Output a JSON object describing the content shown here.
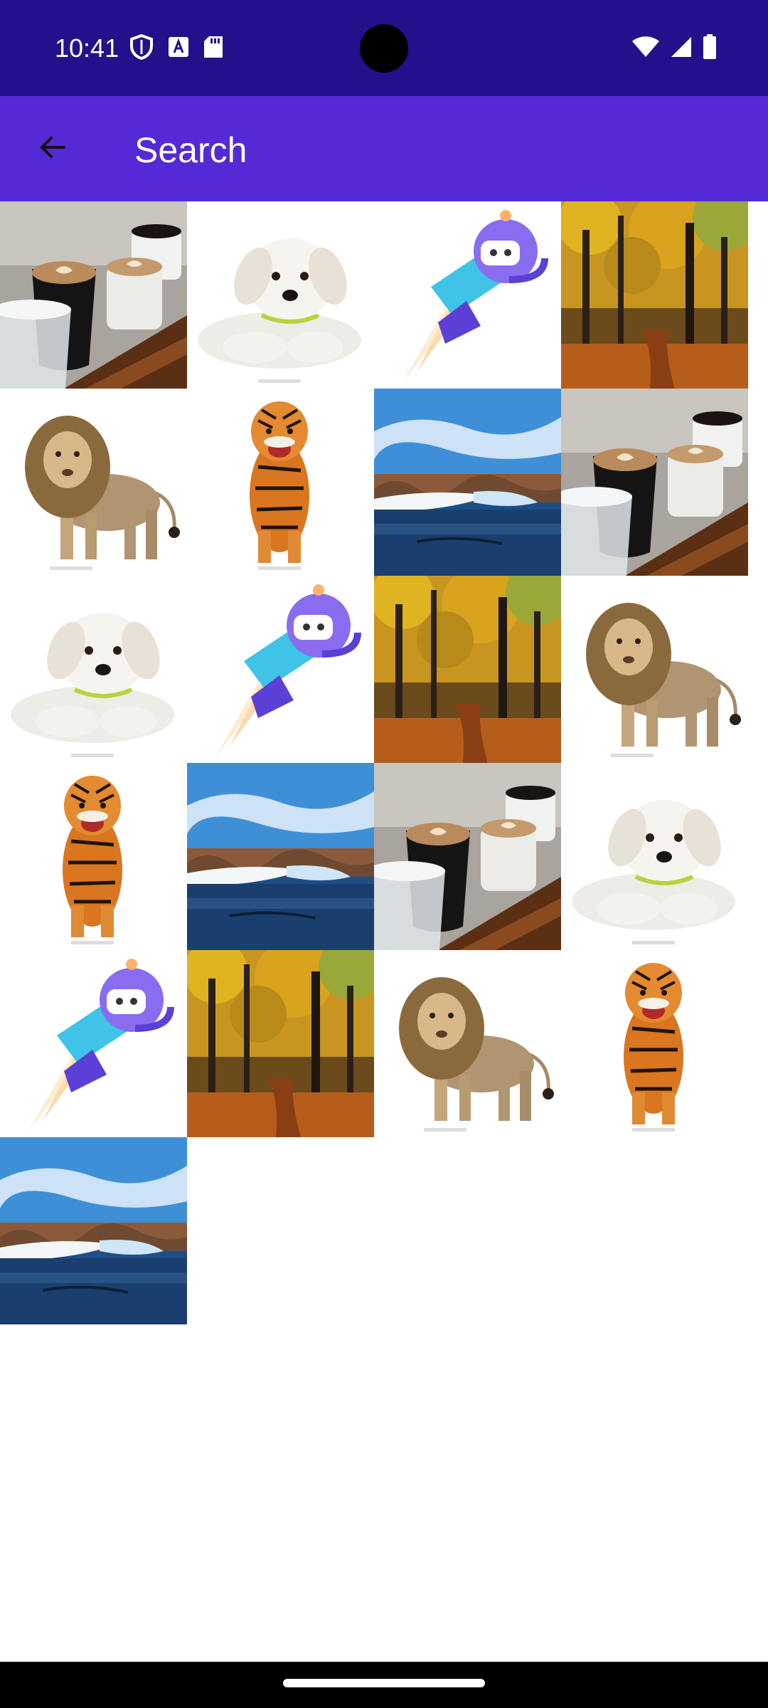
{
  "status_bar": {
    "time": "10:41",
    "left_icons": [
      "shield-icon",
      "font-a-icon",
      "sd-card-icon"
    ],
    "right_icons": [
      "wifi-icon",
      "signal-icon",
      "battery-icon"
    ],
    "colors": {
      "background": "#24108a"
    }
  },
  "app_bar": {
    "title": "Search",
    "back_icon": "arrow-back-icon",
    "colors": {
      "background": "#552ad6",
      "foreground": "#ffffff"
    }
  },
  "grid": {
    "columns": 4,
    "items": [
      "coffee",
      "puppy",
      "robot",
      "forest",
      "lion",
      "tiger",
      "lake",
      "coffee",
      "puppy",
      "robot",
      "forest",
      "lion",
      "tiger",
      "lake",
      "coffee",
      "puppy",
      "robot",
      "forest",
      "lion",
      "tiger",
      "lake"
    ]
  }
}
